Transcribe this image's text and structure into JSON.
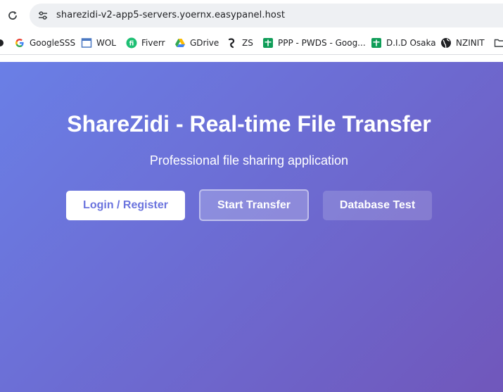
{
  "browser": {
    "url": "sharezidi-v2-app5-servers.yoernx.easypanel.host",
    "bookmarks": [
      {
        "label": "GoogleSSS",
        "icon": "google-icon"
      },
      {
        "label": "WOL",
        "icon": "window-icon"
      },
      {
        "label": "Fiverr",
        "icon": "fiverr-icon"
      },
      {
        "label": "GDrive",
        "icon": "drive-icon"
      },
      {
        "label": "ZS",
        "icon": "zs-icon"
      },
      {
        "label": "PPP - PWDS - Goog...",
        "icon": "sheets-icon"
      },
      {
        "label": "D.I.D Osaka",
        "icon": "sheets-icon"
      },
      {
        "label": "NZINIT",
        "icon": "globe-icon"
      }
    ]
  },
  "page": {
    "title": "ShareZidi - Real-time File Transfer",
    "subtitle": "Professional file sharing application",
    "buttons": {
      "login": "Login / Register",
      "start": "Start Transfer",
      "database": "Database Test"
    }
  },
  "colors": {
    "gradient_start": "#6a7fe6",
    "gradient_end": "#7057bb",
    "accent_text": "#6b74de"
  }
}
